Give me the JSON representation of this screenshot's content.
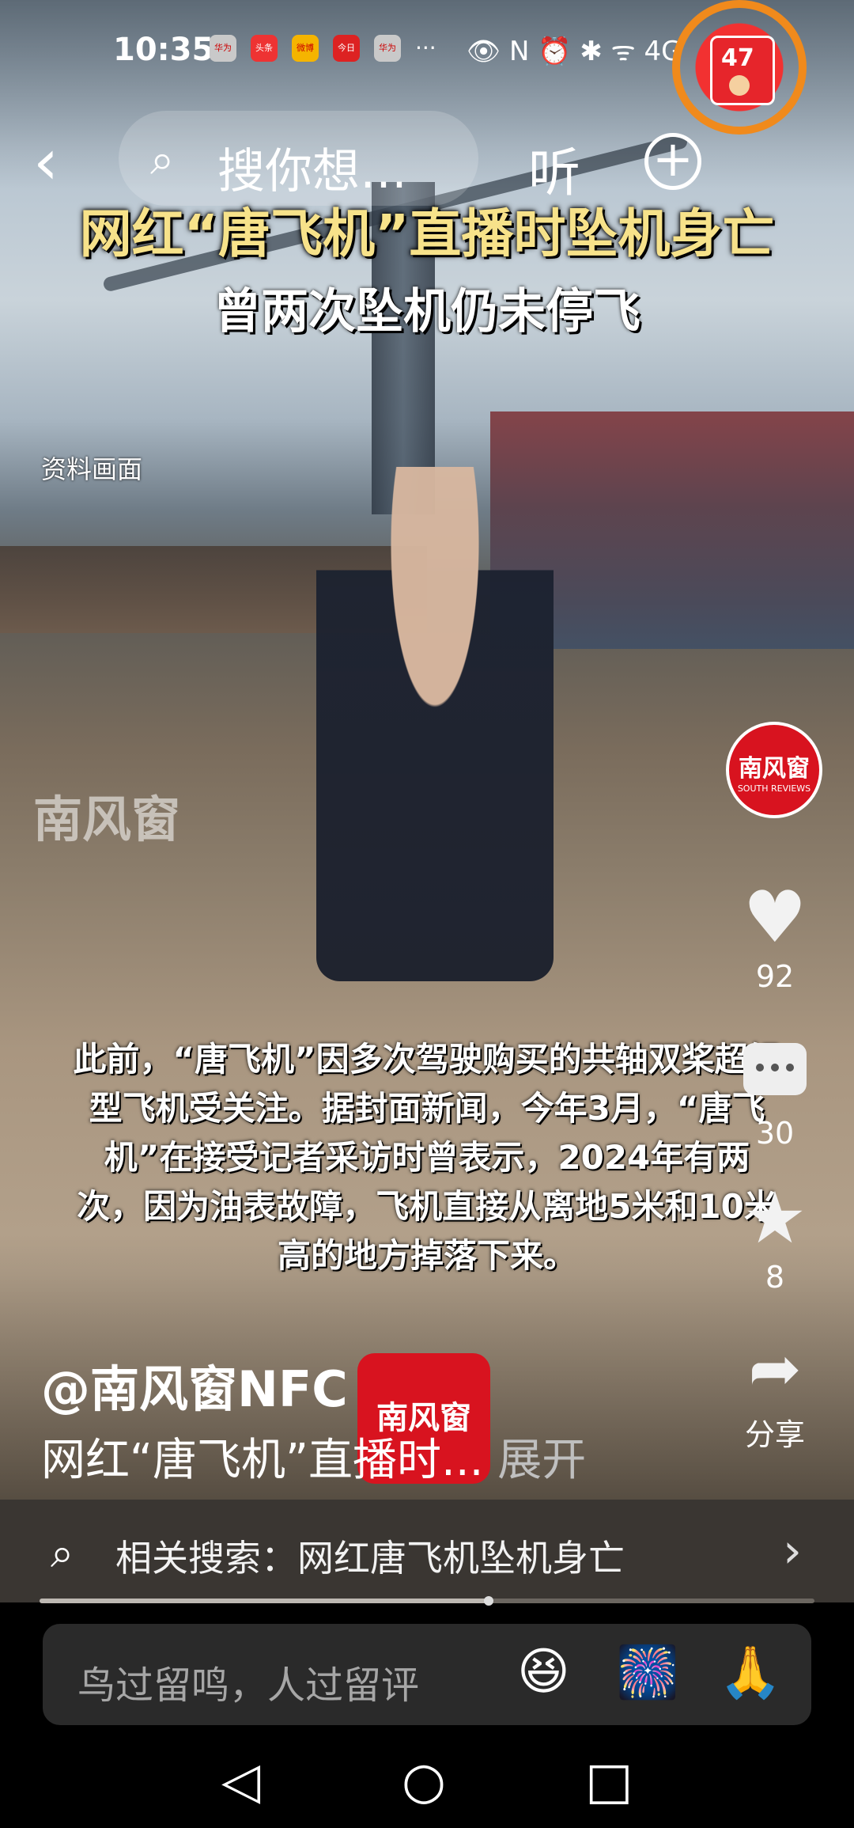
{
  "status_bar": {
    "time": "10:35",
    "apps": [
      "华为",
      "头条",
      "微博",
      "今日",
      "华为"
    ],
    "more": "···",
    "right_icons": "👁 N ⏰ ✱ ᯤ 4G",
    "red_packet_count": "47"
  },
  "top_nav": {
    "back_label": "‹",
    "search_icon": "⌕",
    "search_placeholder": "搜你想…",
    "listen_label": "听",
    "add_label": "+"
  },
  "video": {
    "title_line1": "网红“唐飞机”直播时坠机身亡",
    "title_line2": "曾两次坠机仍未停飞",
    "archive_tag": "资料画面",
    "watermark": "南风窗",
    "subtitle": "此前，“唐飞机”因多次驾驶购买的共轴双桨超轻型飞机受关注。据封面新闻，今年3月，“唐飞机”在接受记者采访时曾表示，2024年有两次，因为油表故障，飞机直接从离地5米和10米高的地方掉落下来。"
  },
  "actions": {
    "avatar_brand": "南风窗",
    "avatar_sub": "SOUTH REVIEWS",
    "likes": "92",
    "comments": "30",
    "favorites": "8",
    "share_label": "分享"
  },
  "post": {
    "author": "@南风窗NFC",
    "logo_text": "南风窗",
    "description": "网红“唐飞机”直播时...",
    "expand_label": "展开"
  },
  "related": {
    "icon": "⌕",
    "text": "相关搜索：网红唐飞机坠机身亡",
    "arrow": "›"
  },
  "progress": 0.58,
  "comment": {
    "placeholder": "鸟过留鸣，人过留评",
    "emojis": [
      "😆",
      "🎆",
      "🙏"
    ]
  },
  "system_nav": {
    "back": "◁",
    "home": "○",
    "recents": "□"
  }
}
